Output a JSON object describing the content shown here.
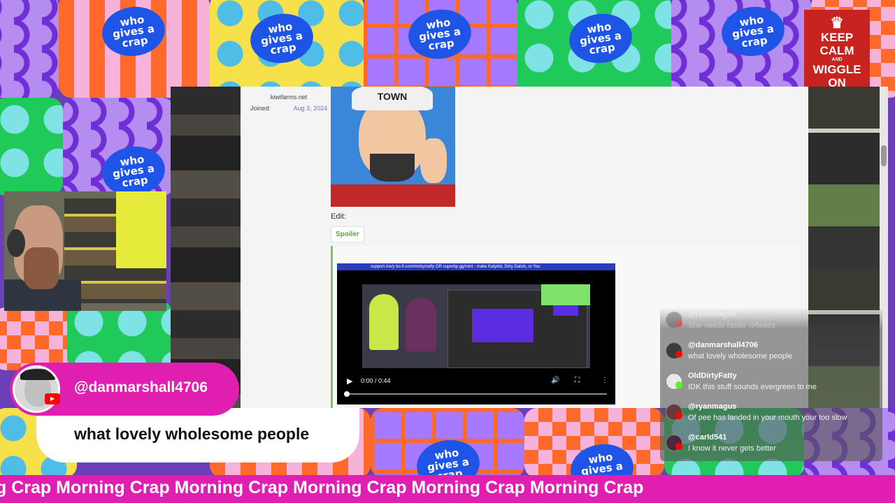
{
  "background": {
    "logo_text": "who gives a crap",
    "colors": {
      "ticker": "#e01fb0",
      "spoiler_accent": "#7bc46a",
      "keepcalm_red": "#c8231e"
    }
  },
  "keepcalm": {
    "line1": "KEEP",
    "line2": "CALM",
    "line3": "AND",
    "line4": "WIGGLE",
    "line5": "ON",
    "icon": "crown-icon"
  },
  "browser": {
    "user_site": "kiwifarms.net",
    "joined_label": "Joined:",
    "joined_date": "Aug 3, 2024",
    "avatar_cap_text": "TOWN",
    "edit_label": "Edit:",
    "spoiler_label": "Spoiler",
    "video": {
      "banner": "support.me/y ko-fi.com/mintycrafty OR supertip.gg/mint - make Katydid, Dirty Dalish, or You",
      "time": "0:00 / 0:44",
      "progress": 0
    }
  },
  "highlight": {
    "username": "@danmarshall4706",
    "message": "what lovely wholesome people"
  },
  "chat": [
    {
      "user": "@ryanmagus",
      "text": "She needs faster reflexes",
      "platform": "youtube"
    },
    {
      "user": "@danmarshall4706",
      "text": "what lovely wholesome people",
      "platform": "youtube"
    },
    {
      "user": "OldDirtyFatty",
      "text": "IDK this stuff sounds evergreen to me",
      "platform": "kick"
    },
    {
      "user": "@ryanmagus",
      "text": "Of pee has landed in your mouth your too slow",
      "platform": "youtube"
    },
    {
      "user": "@carld541",
      "text": "I know it never gets better",
      "platform": "youtube"
    }
  ],
  "ticker": {
    "text": "g Crap Morning Crap Morning Crap Morning Crap Morning Crap Morning Crap"
  }
}
